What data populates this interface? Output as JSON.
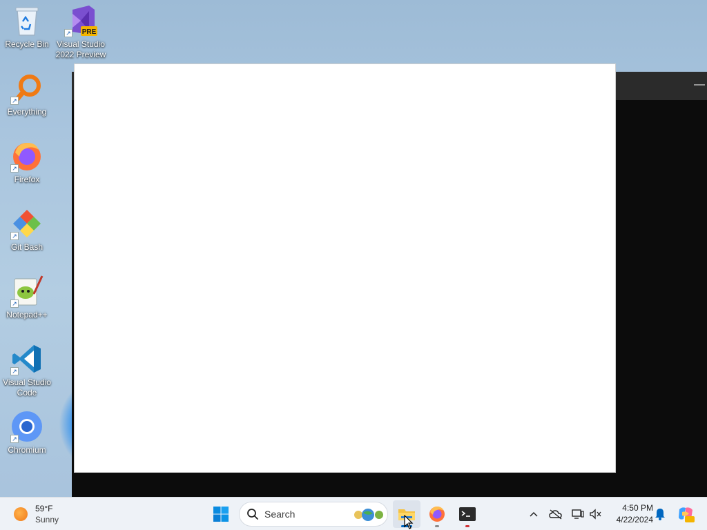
{
  "desktop": {
    "icons": [
      {
        "label": "Recycle Bin",
        "icon": "recycle-bin-icon"
      },
      {
        "label": "Visual Studio 2022 Preview",
        "badge": "PRE",
        "icon": "visual-studio-icon"
      },
      {
        "label": "Everything",
        "icon": "everything-search-icon"
      },
      {
        "label": "Firefox",
        "icon": "firefox-icon"
      },
      {
        "label": "Git Bash",
        "icon": "git-bash-icon"
      },
      {
        "label": "Notepad++",
        "icon": "notepad-plus-plus-icon"
      },
      {
        "label": "Visual Studio Code",
        "icon": "vscode-icon"
      },
      {
        "label": "Chromium",
        "icon": "chromium-icon"
      }
    ]
  },
  "terminal_window": {
    "minimize_glyph": "—"
  },
  "taskbar": {
    "weather": {
      "temp": "59°F",
      "condition": "Sunny"
    },
    "search": {
      "label": "Search"
    },
    "apps": [
      {
        "name": "start",
        "icon": "windows-start-icon"
      },
      {
        "name": "file-explorer",
        "icon": "folder-icon",
        "active": true
      },
      {
        "name": "firefox",
        "icon": "firefox-icon"
      },
      {
        "name": "terminal",
        "icon": "terminal-icon"
      }
    ],
    "tray": {
      "time": "4:50 PM",
      "date": "4/22/2024"
    },
    "colors": {
      "accent": "#0067c0",
      "terminal_indicator": "#d13438"
    }
  }
}
